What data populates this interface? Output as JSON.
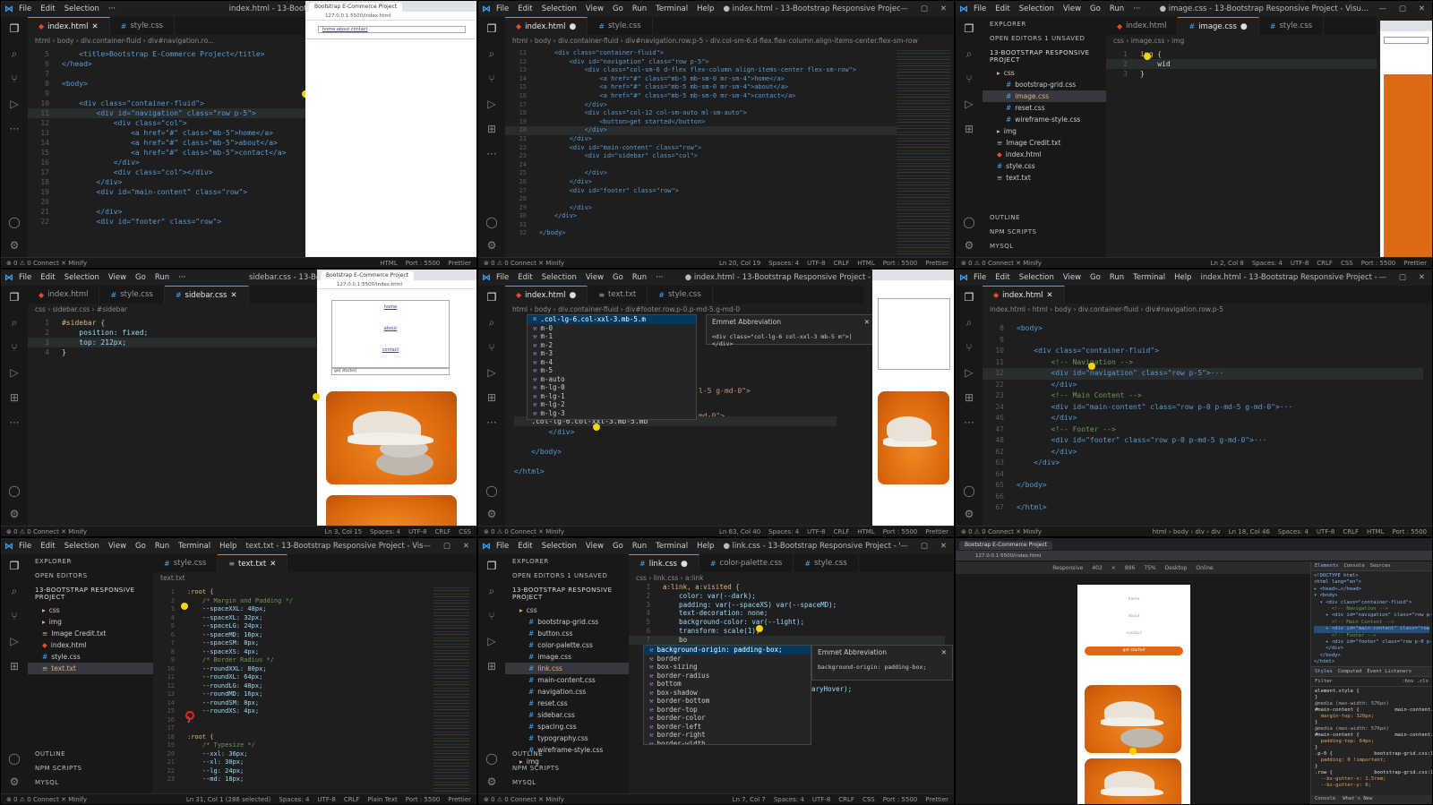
{
  "p1": {
    "menu": [
      "File",
      "Edit",
      "Selection",
      "···"
    ],
    "title": "index.html - 13-Bootstrap R...",
    "tabs": [
      {
        "label": "index.html",
        "active": true
      },
      {
        "label": "style.css",
        "active": false
      }
    ],
    "crumbs": "html › body › div.container-fluid › div#navigation.ro...",
    "lines": [
      {
        "n": "5",
        "t": "    <title>Bootstrap E-Commerce Project</title>"
      },
      {
        "n": "6",
        "t": "</head>"
      },
      {
        "n": "7",
        "t": ""
      },
      {
        "n": "8",
        "t": "<body>"
      },
      {
        "n": "9",
        "t": ""
      },
      {
        "n": "10",
        "t": "    <div class=\"container-fluid\">"
      },
      {
        "n": "11",
        "t": "        <div id=\"navigation\" class=\"row p-5\">"
      },
      {
        "n": "12",
        "t": "            <div class=\"col\">"
      },
      {
        "n": "13",
        "t": "                <a href=\"#\" class=\"mb-5\">home</a>"
      },
      {
        "n": "14",
        "t": "                <a href=\"#\" class=\"mb-5\">about</a>"
      },
      {
        "n": "15",
        "t": "                <a href=\"#\" class=\"mb-5\">contact</a>"
      },
      {
        "n": "16",
        "t": "            </div>"
      },
      {
        "n": "17",
        "t": "            <div class=\"col\"></div>"
      },
      {
        "n": "18",
        "t": "        </div>"
      },
      {
        "n": "19",
        "t": "        <div id=\"main-content\" class=\"row\">"
      },
      {
        "n": "20",
        "t": ""
      },
      {
        "n": "21",
        "t": "        </div>"
      },
      {
        "n": "22",
        "t": "        <div id=\"footer\" class=\"row\">"
      }
    ],
    "status_left": "⊗ 0 ⚠ 0   Connect   ✕ Minify",
    "status_right": [
      "HTML",
      "Port : 5500",
      "Prettier"
    ],
    "browser_tab": "Bootstrap E-Commerce Project",
    "browser_url": "127.0.0.1:5500/index.html",
    "browser_nav": "home about contact"
  },
  "p2": {
    "menu": [
      "File",
      "Edit",
      "Selection",
      "View",
      "Go",
      "Run",
      "Terminal",
      "Help"
    ],
    "title": "● index.html - 13-Bootstrap Responsive Project - Visual Studi...",
    "tabs": [
      {
        "label": "index.html",
        "active": true
      },
      {
        "label": "style.css",
        "active": false
      }
    ],
    "crumbs": "html › body › div.container-fluid › div#navigation.row.p-5 › div.col-sm-6.d-flex.flex-column.align-items-center.flex-sm-row",
    "lines": [
      {
        "n": "11",
        "t": "    <div class=\"container-fluid\">"
      },
      {
        "n": "12",
        "t": "        <div id=\"navigation\" class=\"row p-5\">"
      },
      {
        "n": "13",
        "t": "            <div class=\"col-sm-6 d-flex flex-column align-items-center flex-sm-row\">"
      },
      {
        "n": "14",
        "t": "                <a href=\"#\" class=\"mb-5 mb-sm-0 mr-sm-4\">home</a>"
      },
      {
        "n": "15",
        "t": "                <a href=\"#\" class=\"mb-5 mb-sm-0 mr-sm-4\">about</a>"
      },
      {
        "n": "16",
        "t": "                <a href=\"#\" class=\"mb-5 mb-sm-0 mr-sm-4\">contact</a>"
      },
      {
        "n": "17",
        "t": "            </div>"
      },
      {
        "n": "18",
        "t": "            <div class=\"col-12 col-sm-auto ml-sm-auto\">"
      },
      {
        "n": "19",
        "t": "                <button>get started</button>"
      },
      {
        "n": "20",
        "t": "            </div>"
      },
      {
        "n": "21",
        "t": "        </div>"
      },
      {
        "n": "22",
        "t": "        <div id=\"main-content\" class=\"row\">"
      },
      {
        "n": "23",
        "t": "            <div id=\"sidebar\" class=\"col\">"
      },
      {
        "n": "24",
        "t": ""
      },
      {
        "n": "25",
        "t": "            </div>"
      },
      {
        "n": "26",
        "t": "        </div>"
      },
      {
        "n": "27",
        "t": "        <div id=\"footer\" class=\"row\">"
      },
      {
        "n": "28",
        "t": ""
      },
      {
        "n": "29",
        "t": "        </div>"
      },
      {
        "n": "30",
        "t": "    </div>"
      },
      {
        "n": "31",
        "t": ""
      },
      {
        "n": "32",
        "t": "</body>"
      }
    ],
    "status_left": "⊗ 0 ⚠ 0   Connect   ✕ Minify",
    "status_right": [
      "Ln 20, Col 19",
      "Spaces: 4",
      "UTF-8",
      "CRLF",
      "HTML",
      "Port : 5500",
      "Prettier"
    ]
  },
  "p3": {
    "menu": [
      "File",
      "Edit",
      "Selection",
      "View",
      "Go",
      "Run",
      "···"
    ],
    "title": "● image.css - 13-Bootstrap Responsive Project - Visu...",
    "explorer_header": "EXPLORER",
    "open_editors": "OPEN EDITORS   1 UNSAVED",
    "project": "13-BOOTSTRAP RESPONSIVE PROJECT",
    "files": [
      {
        "label": "css",
        "kind": "fold",
        "ind": 1,
        "sel": false
      },
      {
        "label": "bootstrap-grid.css",
        "kind": "css",
        "ind": 2,
        "sel": false
      },
      {
        "label": "image.css",
        "kind": "css",
        "ind": 2,
        "sel": true
      },
      {
        "label": "reset.css",
        "kind": "css",
        "ind": 2,
        "sel": false
      },
      {
        "label": "wireframe-style.css",
        "kind": "css",
        "ind": 2,
        "sel": false
      },
      {
        "label": "img",
        "kind": "fold",
        "ind": 1,
        "sel": false
      },
      {
        "label": "Image Credit.txt",
        "kind": "txt",
        "ind": 1,
        "sel": false
      },
      {
        "label": "index.html",
        "kind": "html",
        "ind": 1,
        "sel": false
      },
      {
        "label": "style.css",
        "kind": "css",
        "ind": 1,
        "sel": false
      },
      {
        "label": "text.txt",
        "kind": "txt",
        "ind": 1,
        "sel": false
      }
    ],
    "sections": [
      "OUTLINE",
      "NPM SCRIPTS",
      "MYSQL"
    ],
    "tabs": [
      {
        "label": "index.html",
        "active": false
      },
      {
        "label": "image.css",
        "active": true
      },
      {
        "label": "style.css",
        "active": false
      }
    ],
    "crumbs": "css › image.css › img",
    "lines": [
      {
        "n": "1",
        "t": "img {"
      },
      {
        "n": "2",
        "t": "    wid"
      },
      {
        "n": "3",
        "t": "}"
      }
    ],
    "status_right": [
      "Ln 2, Col 8",
      "Spaces: 4",
      "UTF-8",
      "CRLF",
      "CSS",
      "Port : 5500",
      "Prettier"
    ]
  },
  "p4": {
    "menu": [
      "File",
      "Edit",
      "Selection",
      "View",
      "Go",
      "Run",
      "···"
    ],
    "title": "sidebar.css - 13-Bootstrap Responsive Proje...",
    "tabs": [
      {
        "label": "index.html",
        "active": false
      },
      {
        "label": "style.css",
        "active": false
      },
      {
        "label": "sidebar.css",
        "active": true
      }
    ],
    "crumbs": "css › sidebar.css › #sidebar",
    "lines": [
      {
        "n": "1",
        "t": "#sidebar {"
      },
      {
        "n": "2",
        "t": "    position: fixed;"
      },
      {
        "n": "3",
        "t": "    top: 212px;"
      },
      {
        "n": "4",
        "t": "}"
      }
    ],
    "status_right": [
      "Ln 3, Col 15",
      "Spaces: 4",
      "UTF-8",
      "CRLF",
      "CSS"
    ],
    "browser_tab": "Bootstrap E-Commerce Project",
    "browser_url": "127.0.0.1:5500/index.html",
    "nav_links": [
      "home",
      "about",
      "contact"
    ],
    "button": "get started"
  },
  "p5": {
    "menu": [
      "File",
      "Edit",
      "Selection",
      "View",
      "Go",
      "Run",
      "···"
    ],
    "title": "● index.html - 13-Bootstrap Responsive Project - Vi...",
    "tabs": [
      {
        "label": "index.html",
        "active": true
      },
      {
        "label": "text.txt",
        "active": false
      },
      {
        "label": "style.css",
        "active": false
      }
    ],
    "crumbs": "html › body › div.container-fluid › div#footer.row.p-0.p-md-5.g-md-0",
    "suggest_head": ".col-lg-6.col-xxl-3.mb-5.m",
    "suggest_items": [
      "m-0",
      "m-1",
      "m-2",
      "m-3",
      "m-4",
      "m-5",
      "m-auto",
      "m-lg-0",
      "m-lg-1",
      "m-lg-2",
      "m-lg-3"
    ],
    "emmet_title": "Emmet Abbreviation",
    "emmet_body": "<div class=\"col-lg-6 col-xxl-3 mb-5 m\">|</div>",
    "typed": "    .col-lg-6.col-xxl-3.mb-5.mb",
    "lines_after": [
      "        </div>",
      "",
      "    </body>",
      "",
      "</html>"
    ],
    "frag1": "l-5 g-md-0\">",
    "frag2": "md-0\">",
    "status_right": [
      "Ln 63, Col 40",
      "Spaces: 4",
      "UTF-8",
      "CRLF",
      "HTML",
      "Port : 5500",
      "Prettier"
    ]
  },
  "p6": {
    "menu": [
      "File",
      "Edit",
      "Selection",
      "View",
      "Go",
      "Run",
      "Terminal",
      "Help"
    ],
    "title": "index.html - 13-Bootstrap Responsive Project - Visual Studio ...",
    "tabs": [
      {
        "label": "index.html",
        "active": true
      }
    ],
    "crumbs": "index.html › html › body › div.container-fluid › div#navigation.row.p-5",
    "lines": [
      {
        "n": "8",
        "t": "<body>"
      },
      {
        "n": "9",
        "t": ""
      },
      {
        "n": "10",
        "t": "    <div class=\"container-fluid\">"
      },
      {
        "n": "11",
        "t": "        <!-- Navigation -->"
      },
      {
        "n": "12",
        "t": "        <div id=\"navigation\" class=\"row p-5\">···"
      },
      {
        "n": "22",
        "t": "        </div>"
      },
      {
        "n": "23",
        "t": "        <!-- Main Content -->"
      },
      {
        "n": "24",
        "t": "        <div id=\"main-content\" class=\"row p-0 p-md-5 g-md-0\">···"
      },
      {
        "n": "46",
        "t": "        </div>"
      },
      {
        "n": "47",
        "t": "        <!-- Footer -->"
      },
      {
        "n": "48",
        "t": "        <div id=\"footer\" class=\"row p-0 p-md-5 g-md-0\">···"
      },
      {
        "n": "62",
        "t": "        </div>"
      },
      {
        "n": "63",
        "t": "    </div>"
      },
      {
        "n": "64",
        "t": ""
      },
      {
        "n": "65",
        "t": "</body>"
      },
      {
        "n": "66",
        "t": ""
      },
      {
        "n": "67",
        "t": "</html>"
      }
    ],
    "status_right": [
      "html › body › div › div",
      "Ln 18, Col 46",
      "Spaces: 4",
      "UTF-8",
      "CRLF",
      "HTML",
      "Port : 5500"
    ]
  },
  "p7": {
    "menu": [
      "File",
      "Edit",
      "Selection",
      "View",
      "Go",
      "Run",
      "Terminal",
      "Help"
    ],
    "title": "text.txt - 13-Bootstrap Responsive Project - Visual Studio C...",
    "explorer_header": "EXPLORER",
    "open_editors": "OPEN EDITORS",
    "project": "13-BOOTSTRAP RESPONSIVE PROJECT",
    "files": [
      {
        "label": "css",
        "kind": "fold",
        "ind": 1,
        "sel": false
      },
      {
        "label": "img",
        "kind": "fold",
        "ind": 1,
        "sel": false
      },
      {
        "label": "Image Credit.txt",
        "kind": "txt",
        "ind": 1,
        "sel": false
      },
      {
        "label": "index.html",
        "kind": "html",
        "ind": 1,
        "sel": false
      },
      {
        "label": "style.css",
        "kind": "css",
        "ind": 1,
        "sel": false
      },
      {
        "label": "text.txt",
        "kind": "txt",
        "ind": 1,
        "sel": true
      }
    ],
    "sections": [
      "OUTLINE",
      "NPM SCRIPTS",
      "MYSQL"
    ],
    "tabs": [
      {
        "label": "style.css",
        "active": false
      },
      {
        "label": "text.txt",
        "active": true
      }
    ],
    "crumbs": "text.txt",
    "lines": [
      {
        "n": "1",
        "t": ":root {"
      },
      {
        "n": "2",
        "t": "    /* Margin and Padding */"
      },
      {
        "n": "3",
        "t": "    --spaceXXL: 48px;"
      },
      {
        "n": "4",
        "t": "    --spaceXL: 32px;"
      },
      {
        "n": "5",
        "t": "    --spaceLG: 24px;"
      },
      {
        "n": "6",
        "t": "    --spaceMD: 16px;"
      },
      {
        "n": "7",
        "t": "    --spaceSM: 8px;"
      },
      {
        "n": "8",
        "t": "    --spaceXS: 4px;"
      },
      {
        "n": "9",
        "t": "    /* Border Radius */"
      },
      {
        "n": "10",
        "t": "    --roundXXL: 80px;"
      },
      {
        "n": "11",
        "t": "    --roundXL: 64px;"
      },
      {
        "n": "12",
        "t": "    --roundLG: 48px;"
      },
      {
        "n": "13",
        "t": "    --roundMD: 16px;"
      },
      {
        "n": "14",
        "t": "    --roundSM: 8px;"
      },
      {
        "n": "15",
        "t": "    --roundXS: 4px;"
      },
      {
        "n": "16",
        "t": "}"
      },
      {
        "n": "17",
        "t": ""
      },
      {
        "n": "18",
        "t": ":root {"
      },
      {
        "n": "19",
        "t": "    /* Typesize */"
      },
      {
        "n": "20",
        "t": "    --xxl: 36px;"
      },
      {
        "n": "21",
        "t": "    --xl: 30px;"
      },
      {
        "n": "22",
        "t": "    --lg: 24px;"
      },
      {
        "n": "23",
        "t": "    --md: 18px;"
      }
    ],
    "status_right": [
      "Ln 31, Col 1 (286 selected)",
      "Spaces: 4",
      "UTF-8",
      "CRLF",
      "Plain Text",
      "Port : 5500",
      "Prettier"
    ]
  },
  "p8": {
    "menu": [
      "File",
      "Edit",
      "Selection",
      "View",
      "Go",
      "Run",
      "Terminal",
      "Help"
    ],
    "title": "● link.css - 13-Bootstrap Responsive Project - Visual Studio C...",
    "explorer_header": "EXPLORER",
    "open_editors": "OPEN EDITORS   1 UNSAVED",
    "project": "13-BOOTSTRAP RESPONSIVE PROJECT",
    "files": [
      {
        "label": "css",
        "kind": "fold",
        "ind": 1,
        "sel": false
      },
      {
        "label": "bootstrap-grid.css",
        "kind": "css",
        "ind": 2,
        "sel": false
      },
      {
        "label": "button.css",
        "kind": "css",
        "ind": 2,
        "sel": false
      },
      {
        "label": "color-palette.css",
        "kind": "css",
        "ind": 2,
        "sel": false
      },
      {
        "label": "image.css",
        "kind": "css",
        "ind": 2,
        "sel": false
      },
      {
        "label": "link.css",
        "kind": "css",
        "ind": 2,
        "sel": true
      },
      {
        "label": "main-content.css",
        "kind": "css",
        "ind": 2,
        "sel": false
      },
      {
        "label": "navigation.css",
        "kind": "css",
        "ind": 2,
        "sel": false
      },
      {
        "label": "reset.css",
        "kind": "css",
        "ind": 2,
        "sel": false
      },
      {
        "label": "sidebar.css",
        "kind": "css",
        "ind": 2,
        "sel": false
      },
      {
        "label": "spacing.css",
        "kind": "css",
        "ind": 2,
        "sel": false
      },
      {
        "label": "typography.css",
        "kind": "css",
        "ind": 2,
        "sel": false
      },
      {
        "label": "wireframe-style.css",
        "kind": "css",
        "ind": 2,
        "sel": false
      },
      {
        "label": "img",
        "kind": "fold",
        "ind": 1,
        "sel": false
      }
    ],
    "sections": [
      "OUTLINE",
      "NPM SCRIPTS",
      "MYSQL"
    ],
    "tabs": [
      {
        "label": "link.css",
        "active": true
      },
      {
        "label": "color-palette.css",
        "active": false
      },
      {
        "label": "style.css",
        "active": false
      }
    ],
    "crumbs": "css › link.css › a:link",
    "lines": [
      {
        "n": "1",
        "t": "a:link, a:visited {"
      },
      {
        "n": "2",
        "t": "    color: var(--dark);"
      },
      {
        "n": "3",
        "t": "    padding: var(--spaceXS) var(--spaceMD);"
      },
      {
        "n": "4",
        "t": "    text-decoration: none;"
      },
      {
        "n": "5",
        "t": "    background-color: var(--light);"
      },
      {
        "n": "6",
        "t": "    transform: scale(1);"
      },
      {
        "n": "7",
        "t": "    bo"
      }
    ],
    "suggest_items": [
      "background-origin: padding-box;",
      "border",
      "box-sizing",
      "border-radius",
      "bottom",
      "box-shadow",
      "border-bottom",
      "border-top",
      "border-color",
      "border-left",
      "border-right",
      "border-width"
    ],
    "emmet_title": "Emmet Abbreviation",
    "emmet_body": "background-origin: padding-box;",
    "after_frag": "aryHover);",
    "status_right": [
      "Ln 7, Col 7",
      "Spaces: 4",
      "UTF-8",
      "CRLF",
      "CSS",
      "Port : 5500",
      "Prettier"
    ]
  },
  "p9": {
    "browser_tab": "Bootstrap E-Commerce Project",
    "browser_url": "127.0.0.1:5500/index.html",
    "device": "Responsive",
    "size_w": "402",
    "size_h": "896",
    "zoom": "75%",
    "mode": "Desktop",
    "net": "Online",
    "nav_links": [
      "home",
      "about",
      "contact"
    ],
    "button": "get started",
    "devtools_tabs": [
      "Elements",
      "Console",
      "Sources"
    ],
    "dom_lines": [
      "<!DOCTYPE html>",
      "<html lang=\"en\">",
      "▸ <head>…</head>",
      "▾ <body>",
      "  ▾ <div class=\"container-fluid\">",
      "      <!-- Navigation -->",
      "    ▸ <div id=\"navigation\" class=\"row p-5\">",
      "      <!-- Main Content -->",
      "    ▸ <div id=\"main-content\" class=\"row p-0 p-md-5 g-md-0\"> == $0",
      "      <!-- Footer -->",
      "    ▸ <div id=\"footer\" class=\"row p-0 p-md-5 g-md-0\">…</div>",
      "    </div>",
      "  </body>",
      "</html>"
    ],
    "styles_tabs": [
      "Styles",
      "Computed",
      "Event Listeners"
    ],
    "filter": "Filter",
    "filter_hint": ":hov .cls",
    "css_lines": [
      "element.style {",
      "}",
      "@media (max-width: 576px)",
      "#main-content {            main-content.css:16",
      "  margin-top: 320px;",
      "}",
      "@media (max-width: 576px)",
      "#main-content {            main-content.css:15",
      "  padding-top: 64px;",
      "}",
      ".p-0 {              bootstrap-grid.css:1149",
      "  padding: 0 !important;",
      "}",
      ".row {              bootstrap-grid.css:182",
      "  --bs-gutter-x: 1.5rem;",
      "  --bs-gutter-y: 0;"
    ],
    "console_tabs": [
      "Console",
      "What's New"
    ]
  }
}
